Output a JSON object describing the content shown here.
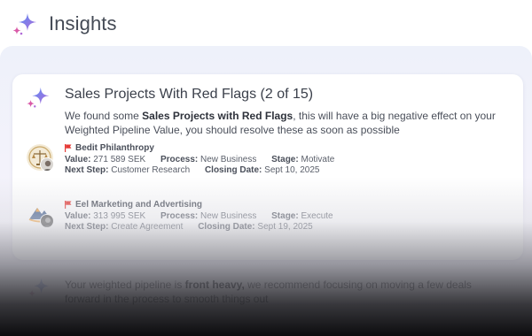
{
  "header": {
    "title": "Insights",
    "icon": "sparkle-icon"
  },
  "card": {
    "title": "Sales Projects With Red Flags (2 of 15)",
    "desc_pre": "We found some ",
    "desc_bold": "Sales Projects with Red Flags",
    "desc_post": ", this will have a big negative effect on your Weighted Pipeline Value, you should resolve these as soon as possible",
    "labels": {
      "value": "Value:",
      "process": "Process:",
      "stage": "Stage:",
      "next_step": "Next Step:",
      "closing_date": "Closing Date:"
    },
    "deals": [
      {
        "name": "Bedit Philanthropy",
        "value": "271 589 SEK",
        "process": "New Business",
        "stage": "Motivate",
        "next_step": "Customer Research",
        "closing_date": "Sept 10, 2025",
        "flag_color": "#e53935"
      },
      {
        "name": "Eel Marketing and Advertising",
        "value": "313 995 SEK",
        "process": "New Business",
        "stage": "Execute",
        "next_step": "Create Agreement",
        "closing_date": "Sept 19, 2025",
        "flag_color": "#e53935"
      }
    ]
  },
  "bottom": {
    "text_pre": "Your weighted pipeline is ",
    "text_bold": "front heavy,",
    "text_post": " we recommend focusing on moving a few deals forward in the process to smooth things out"
  },
  "colors": {
    "sparkle_blue": "#4a7cf0",
    "sparkle_purple": "#b36bd8",
    "sparkle_pink": "#e05aa8"
  }
}
